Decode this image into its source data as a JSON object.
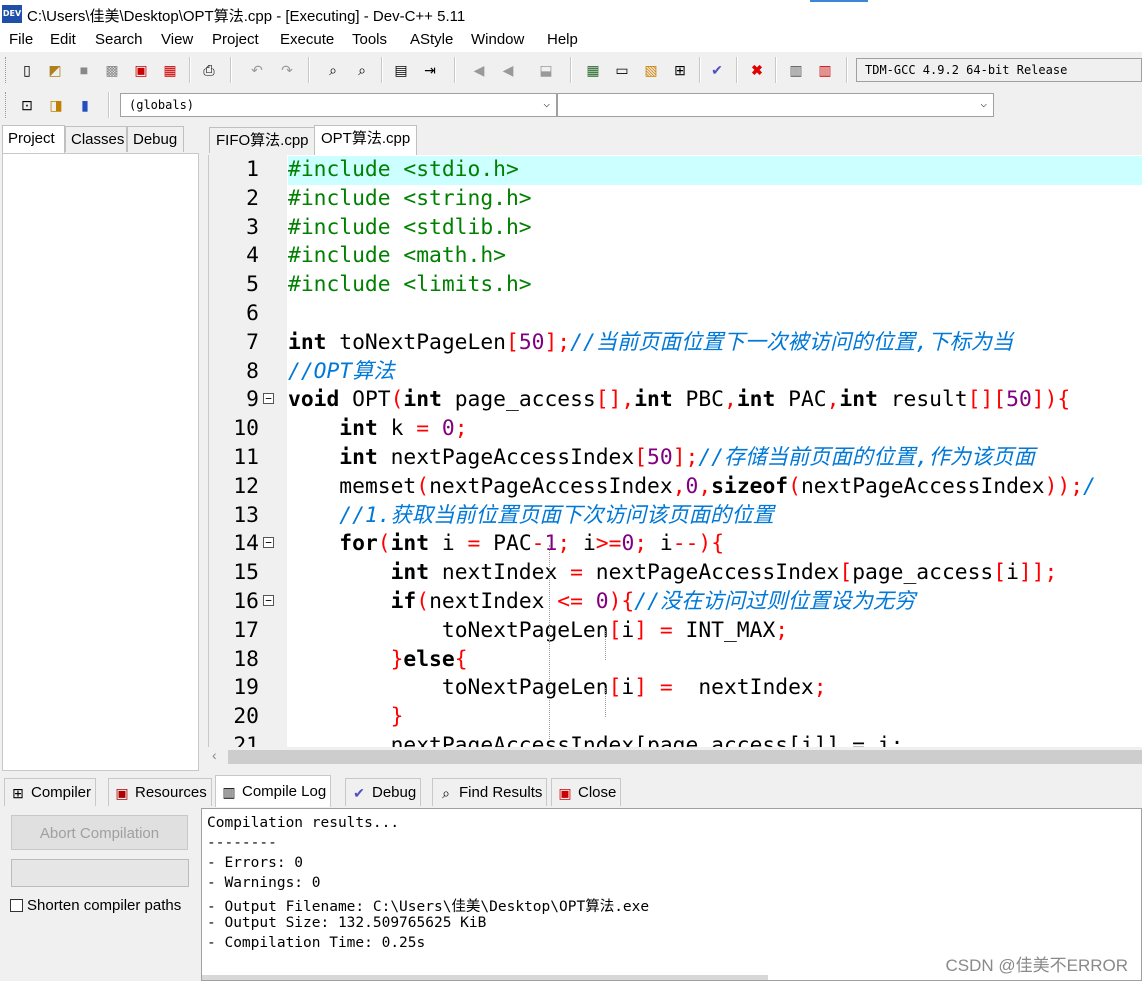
{
  "window": {
    "title": "C:\\Users\\佳美\\Desktop\\OPT算法.cpp - [Executing] - Dev-C++ 5.11",
    "icon_label": "DEV"
  },
  "menu": [
    "File",
    "Edit",
    "Search",
    "View",
    "Project",
    "Execute",
    "Tools",
    "AStyle",
    "Window",
    "Help"
  ],
  "toolbar": {
    "compiler_select": "TDM-GCC 4.9.2 64-bit Release",
    "scope_select": "(globals)",
    "function_select": ""
  },
  "left_panel": {
    "tabs": [
      "Project",
      "Classes",
      "Debug"
    ]
  },
  "editor_tabs": [
    "FIFO算法.cpp",
    "OPT算法.cpp"
  ],
  "code": {
    "line_numbers": [
      "1",
      "2",
      "3",
      "4",
      "5",
      "6",
      "7",
      "8",
      "9",
      "10",
      "11",
      "12",
      "13",
      "14",
      "15",
      "16",
      "17",
      "18",
      "19",
      "20",
      "21"
    ],
    "lines": {
      "l1a": "#include <stdio.h>",
      "l2a": "#include <string.h>",
      "l3a": "#include <stdlib.h>",
      "l4a": "#include <math.h>",
      "l5a": "#include <limits.h>",
      "l7kw": "int",
      "l7a": " toNextPageLen",
      "l7b": "[",
      "l7n": "50",
      "l7c": "];",
      "l7cm": "//当前页面位置下一次被访问的位置,下标为当",
      "l8cm": "//OPT算法",
      "l9kw": "void",
      "l9a": " OPT",
      "l9b": "(",
      "l9kw2": "int",
      "l9c": " page_access",
      "l9d": "[],",
      "l9kw3": "int",
      "l9e": " PBC",
      "l9f": ",",
      "l9kw4": "int",
      "l9g": " PAC",
      "l9h": ",",
      "l9kw5": "int",
      "l9i": " result",
      "l9j": "[][",
      "l9n": "50",
      "l9k": "]){",
      "l10kw": "int",
      "l10a": " k ",
      "l10b": "=",
      "l10n": " 0",
      "l10c": ";",
      "l11kw": "int",
      "l11a": " nextPageAccessIndex",
      "l11b": "[",
      "l11n": "50",
      "l11c": "];",
      "l11cm": "//存储当前页面的位置,作为该页面",
      "l12a": "memset",
      "l12b": "(",
      "l12c": "nextPageAccessIndex",
      "l12d": ",",
      "l12n": "0",
      "l12e": ",",
      "l12kw": "sizeof",
      "l12f": "(",
      "l12g": "nextPageAccessIndex",
      "l12h": "));",
      "l12cm": "/",
      "l13cm": "//1.获取当前位置页面下次访问该页面的位置",
      "l14kw": "for",
      "l14a": "(",
      "l14kw2": "int",
      "l14b": " i ",
      "l14c": "=",
      "l14d": " PAC",
      "l14e": "-",
      "l14n": "1",
      "l14f": ";",
      "l14g": " i",
      "l14h": ">=",
      "l14n2": "0",
      "l14i": ";",
      "l14j": " i",
      "l14k": "--){",
      "l15kw": "int",
      "l15a": " nextIndex ",
      "l15b": "=",
      "l15c": " nextPageAccessIndex",
      "l15d": "[",
      "l15e": "page_access",
      "l15f": "[",
      "l15g": "i",
      "l15h": "]];",
      "l16kw": "if",
      "l16a": "(",
      "l16b": "nextIndex ",
      "l16c": "<=",
      "l16n": " 0",
      "l16d": "){",
      "l16cm": "//没在访问过则位置设为无穷",
      "l17a": "toNextPageLen",
      "l17b": "[",
      "l17c": "i",
      "l17d": "]",
      "l17e": " =",
      "l17f": " INT_MAX",
      "l17g": ";",
      "l18a": "}",
      "l18kw": "else",
      "l18b": "{",
      "l19a": "toNextPageLen",
      "l19b": "[",
      "l19c": "i",
      "l19d": "]",
      "l19e": " =",
      "l19f": "  nextIndex",
      "l19g": ";",
      "l20a": "}",
      "l21a": "nextPageAccessIndex[page_access[i]] = i;"
    }
  },
  "bottom_tabs": [
    "Compiler",
    "Resources",
    "Compile Log",
    "Debug",
    "Find Results",
    "Close"
  ],
  "bottom_panel": {
    "abort_label": "Abort Compilation",
    "shorten_label": "Shorten compiler paths",
    "log": [
      "Compilation results...",
      "--------",
      "- Errors: 0",
      "- Warnings: 0",
      "- Output Filename: C:\\Users\\佳美\\Desktop\\OPT算法.exe",
      "- Output Size: 132.509765625 KiB",
      "- Compilation Time: 0.25s"
    ]
  },
  "watermark": "CSDN @佳美不ERROR",
  "colors": {
    "preprocessor": "#008000",
    "symbol": "#ff0000",
    "number": "#800080",
    "comment": "#0078d7",
    "current_line": "#ccffff"
  }
}
